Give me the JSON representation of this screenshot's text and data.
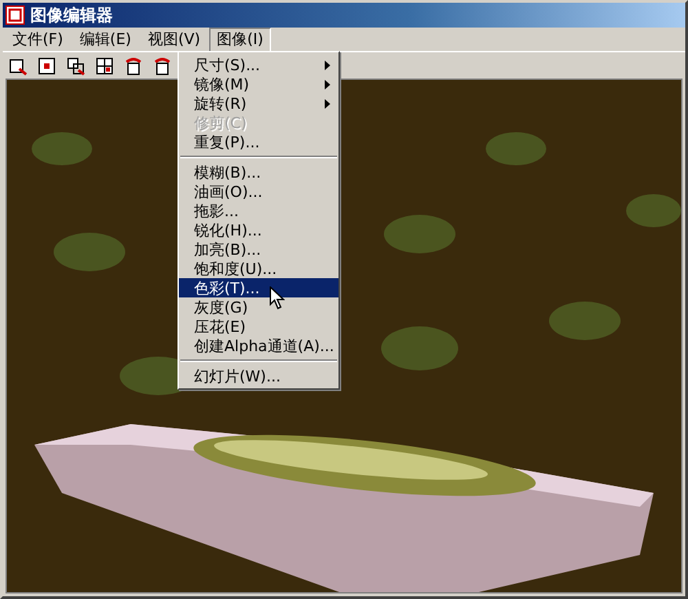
{
  "window": {
    "title": "图像编辑器"
  },
  "menubar": [
    {
      "label": "文件(F)",
      "selected": false
    },
    {
      "label": "编辑(E)",
      "selected": false
    },
    {
      "label": "视图(V)",
      "selected": false
    },
    {
      "label": "图像(I)",
      "selected": true
    }
  ],
  "menu": {
    "items": [
      {
        "kind": "item",
        "label": "尺寸(S)...",
        "submenu": true,
        "disabled": false,
        "selected": false
      },
      {
        "kind": "item",
        "label": "镜像(M)",
        "submenu": true,
        "disabled": false,
        "selected": false
      },
      {
        "kind": "item",
        "label": "旋转(R)",
        "submenu": true,
        "disabled": false,
        "selected": false
      },
      {
        "kind": "item",
        "label": "修剪(C)",
        "submenu": false,
        "disabled": true,
        "selected": false
      },
      {
        "kind": "item",
        "label": "重复(P)...",
        "submenu": false,
        "disabled": false,
        "selected": false
      },
      {
        "kind": "separator"
      },
      {
        "kind": "item",
        "label": "模糊(B)...",
        "submenu": false,
        "disabled": false,
        "selected": false
      },
      {
        "kind": "item",
        "label": "油画(O)...",
        "submenu": false,
        "disabled": false,
        "selected": false
      },
      {
        "kind": "item",
        "label": "拖影...",
        "submenu": false,
        "disabled": false,
        "selected": false
      },
      {
        "kind": "item",
        "label": "锐化(H)...",
        "submenu": false,
        "disabled": false,
        "selected": false
      },
      {
        "kind": "item",
        "label": "加亮(B)...",
        "submenu": false,
        "disabled": false,
        "selected": false
      },
      {
        "kind": "item",
        "label": "饱和度(U)...",
        "submenu": false,
        "disabled": false,
        "selected": false
      },
      {
        "kind": "item",
        "label": "色彩(T)...",
        "submenu": false,
        "disabled": false,
        "selected": true
      },
      {
        "kind": "item",
        "label": "灰度(G)",
        "submenu": false,
        "disabled": false,
        "selected": false
      },
      {
        "kind": "item",
        "label": "压花(E)",
        "submenu": false,
        "disabled": false,
        "selected": false
      },
      {
        "kind": "item",
        "label": "创建Alpha通道(A)...",
        "submenu": false,
        "disabled": false,
        "selected": false
      },
      {
        "kind": "separator"
      },
      {
        "kind": "item",
        "label": "幻灯片(W)...",
        "submenu": false,
        "disabled": false,
        "selected": false
      }
    ]
  }
}
